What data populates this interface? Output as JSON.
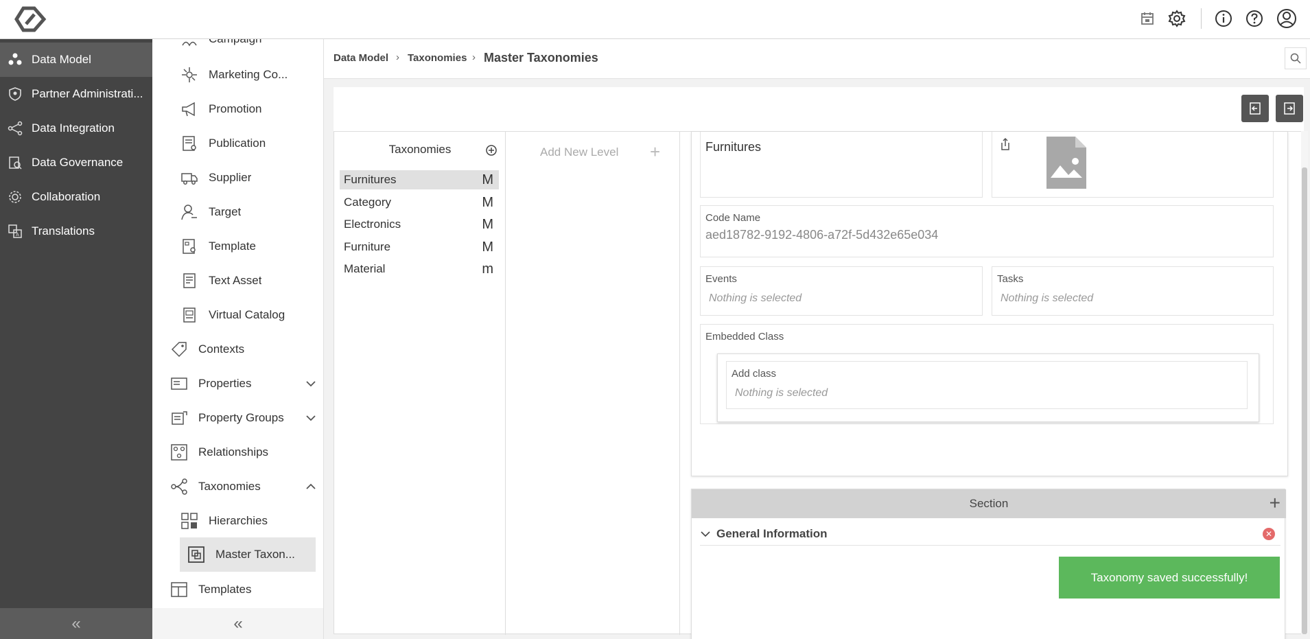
{
  "topbar": {
    "icons": [
      "logo-icon",
      "calendar-icon",
      "gear-icon",
      "info-icon",
      "help-icon",
      "user-icon"
    ]
  },
  "primary_nav": {
    "items": [
      {
        "label": "Data Model",
        "icon": "data-model-icon",
        "active": true
      },
      {
        "label": "Partner Administrati...",
        "icon": "shield-icon"
      },
      {
        "label": "Data Integration",
        "icon": "share-icon"
      },
      {
        "label": "Data Governance",
        "icon": "governance-icon"
      },
      {
        "label": "Collaboration",
        "icon": "collaboration-icon"
      },
      {
        "label": "Translations",
        "icon": "translate-icon"
      }
    ],
    "collapse_label": "«"
  },
  "secondary_nav": {
    "items": [
      {
        "label": "Campaign",
        "icon": "campaign-icon"
      },
      {
        "label": "Marketing Co...",
        "icon": "marketing-icon"
      },
      {
        "label": "Promotion",
        "icon": "megaphone-icon"
      },
      {
        "label": "Publication",
        "icon": "publication-icon"
      },
      {
        "label": "Supplier",
        "icon": "truck-icon"
      },
      {
        "label": "Target",
        "icon": "target-icon"
      },
      {
        "label": "Template",
        "icon": "template-icon"
      },
      {
        "label": "Text Asset",
        "icon": "document-icon"
      },
      {
        "label": "Virtual Catalog",
        "icon": "catalog-icon"
      },
      {
        "label": "Contexts",
        "icon": "tag-icon"
      },
      {
        "label": "Properties",
        "icon": "properties-icon"
      },
      {
        "label": "Property Groups",
        "icon": "property-groups-icon"
      },
      {
        "label": "Relationships",
        "icon": "relationships-icon"
      },
      {
        "label": "Taxonomies",
        "icon": "taxonomies-icon"
      },
      {
        "label": "Hierarchies",
        "icon": "hierarchies-icon"
      },
      {
        "label": "Master Taxon...",
        "icon": "master-taxonomy-icon"
      },
      {
        "label": "Templates",
        "icon": "templates-icon"
      }
    ],
    "collapse_label": "«"
  },
  "breadcrumb": {
    "items": [
      "Data Model",
      "Taxonomies"
    ],
    "current": "Master Taxonomies",
    "separator": "›"
  },
  "taxonomies": {
    "heading": "Taxonomies",
    "rows": [
      {
        "name": "Furnitures",
        "badge": "M",
        "selected": true
      },
      {
        "name": "Category",
        "badge": "M"
      },
      {
        "name": "Electronics",
        "badge": "M"
      },
      {
        "name": "Furniture",
        "badge": "M"
      },
      {
        "name": "Material",
        "badge": "m"
      }
    ]
  },
  "levels": {
    "add_label": "Add New Level",
    "add_symbol": "+"
  },
  "details": {
    "name_value": "Furnitures",
    "code_name_label": "Code Name",
    "code_name_value": "aed18782-9192-4806-a72f-5d432e65e034",
    "events_label": "Events",
    "events_value": "Nothing is selected",
    "tasks_label": "Tasks",
    "tasks_value": "Nothing is selected",
    "embedded_label": "Embedded Class",
    "add_class_label": "Add class",
    "add_class_value": "Nothing is selected"
  },
  "section": {
    "heading": "Section",
    "add_symbol": "+",
    "group_label": "General Information",
    "remove_symbol": "✕"
  },
  "toast": {
    "message": "Taxonomy saved successfully!",
    "color": "#5cb85c"
  },
  "colors": {
    "dark_nav": "#444444",
    "dark_nav_active": "#5c5c5c",
    "section_header": "#d2d2d2"
  }
}
